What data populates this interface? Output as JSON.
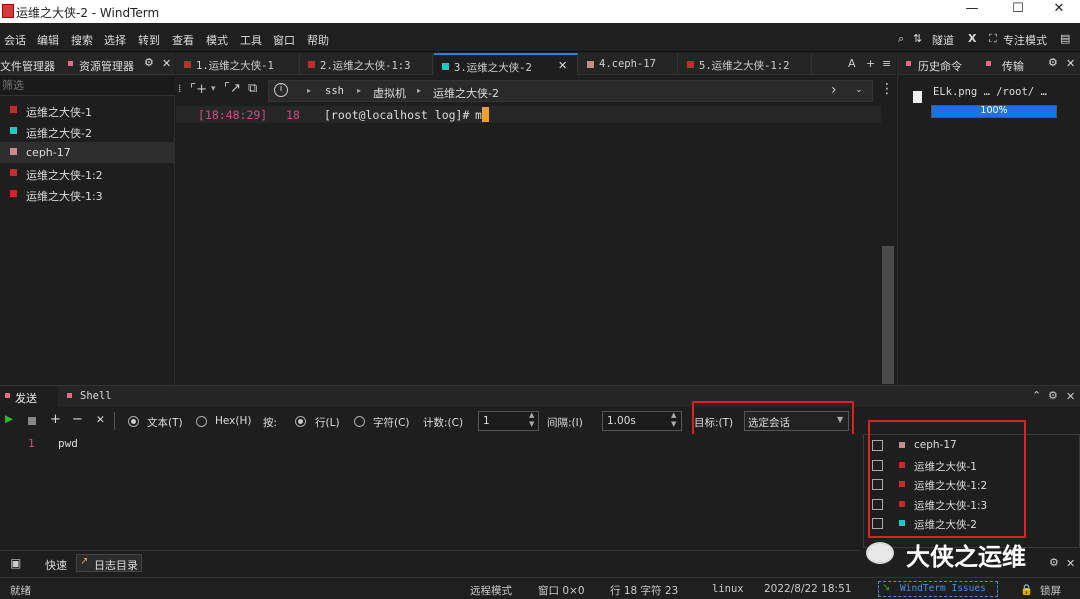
{
  "titlebar": {
    "title": "运维之大侠-2 - WindTerm",
    "minimize": "—",
    "maximize": "☐",
    "close": "✕"
  },
  "menu": {
    "items": [
      "会话",
      "编辑",
      "搜索",
      "选择",
      "转到",
      "查看",
      "模式",
      "工具",
      "窗口",
      "帮助"
    ],
    "right": {
      "tunnel": "隧道",
      "x": "X",
      "focus": "专注模式"
    }
  },
  "left_panel": {
    "tabs": [
      "文件管理器",
      "资源管理器"
    ],
    "filter_placeholder": "筛选",
    "sessions": [
      {
        "label": "运维之大侠-1",
        "color": "#c42b2b"
      },
      {
        "label": "运维之大侠-2",
        "color": "#1fc7c7"
      },
      {
        "label": "ceph-17",
        "color": "#c98c8c"
      },
      {
        "label": "运维之大侠-1:2",
        "color": "#c42b2b"
      },
      {
        "label": "运维之大侠-1:3",
        "color": "#c42b2b"
      }
    ]
  },
  "tabs": [
    {
      "label": "1.运维之大侠-1",
      "color": "#c42b2b"
    },
    {
      "label": "2.运维之大侠-1:3",
      "color": "#c42b2b"
    },
    {
      "label": "3.运维之大侠-2",
      "color": "#1fc7c7"
    },
    {
      "label": "4.ceph-17",
      "color": "#c98c8c"
    },
    {
      "label": "5.运维之大侠-1:2",
      "color": "#c42b2b"
    }
  ],
  "tabbar_right": {
    "font": "A",
    "add": "+",
    "menu": "≡"
  },
  "breadcrumb": {
    "items": [
      "ssh",
      "虚拟机",
      "运维之大侠-2"
    ]
  },
  "terminal": {
    "time": "[18:48:29]",
    "line_no": "18",
    "prompt": "[root@localhost log]#",
    "input": "m"
  },
  "right_panel": {
    "tabs": [
      "历史命令",
      "传输"
    ],
    "transfer": {
      "file": "ELk.png … /root/ …",
      "progress": 1.0,
      "progress_text": "100%"
    }
  },
  "bottom": {
    "tabs": [
      "发送",
      "Shell"
    ],
    "toolbar": {
      "text_label": "文本(T)",
      "hex_label": "Hex(H)",
      "by_label": "按:",
      "line_label": "行(L)",
      "char_label": "字符(C)",
      "count_label": "计数:(C)",
      "count_value": "1",
      "interval_label": "间隔:(I)",
      "interval_value": "1.00s",
      "target_label": "目标:(T)",
      "target_value": "选定会话"
    },
    "editor_line_no": "1",
    "editor_text": "pwd",
    "targets": [
      {
        "label": "ceph-17",
        "color": "#c98c8c"
      },
      {
        "label": "运维之大侠-1",
        "color": "#c42b2b"
      },
      {
        "label": "运维之大侠-1:2",
        "color": "#c42b2b"
      },
      {
        "label": "运维之大侠-1:3",
        "color": "#c42b2b"
      },
      {
        "label": "运维之大侠-2",
        "color": "#1fc7c7"
      }
    ]
  },
  "quickbar": {
    "quick": "快速",
    "log": "日志目录"
  },
  "watermark": "大侠之运维",
  "status": {
    "ready": "就绪",
    "remote": "远程模式",
    "window": "窗口 0×0",
    "pos": "行 18 字符 23",
    "os": "linux",
    "datetime": "2022/8/22 18:51",
    "issues": "WindTerm Issues",
    "lock": "锁屏"
  }
}
